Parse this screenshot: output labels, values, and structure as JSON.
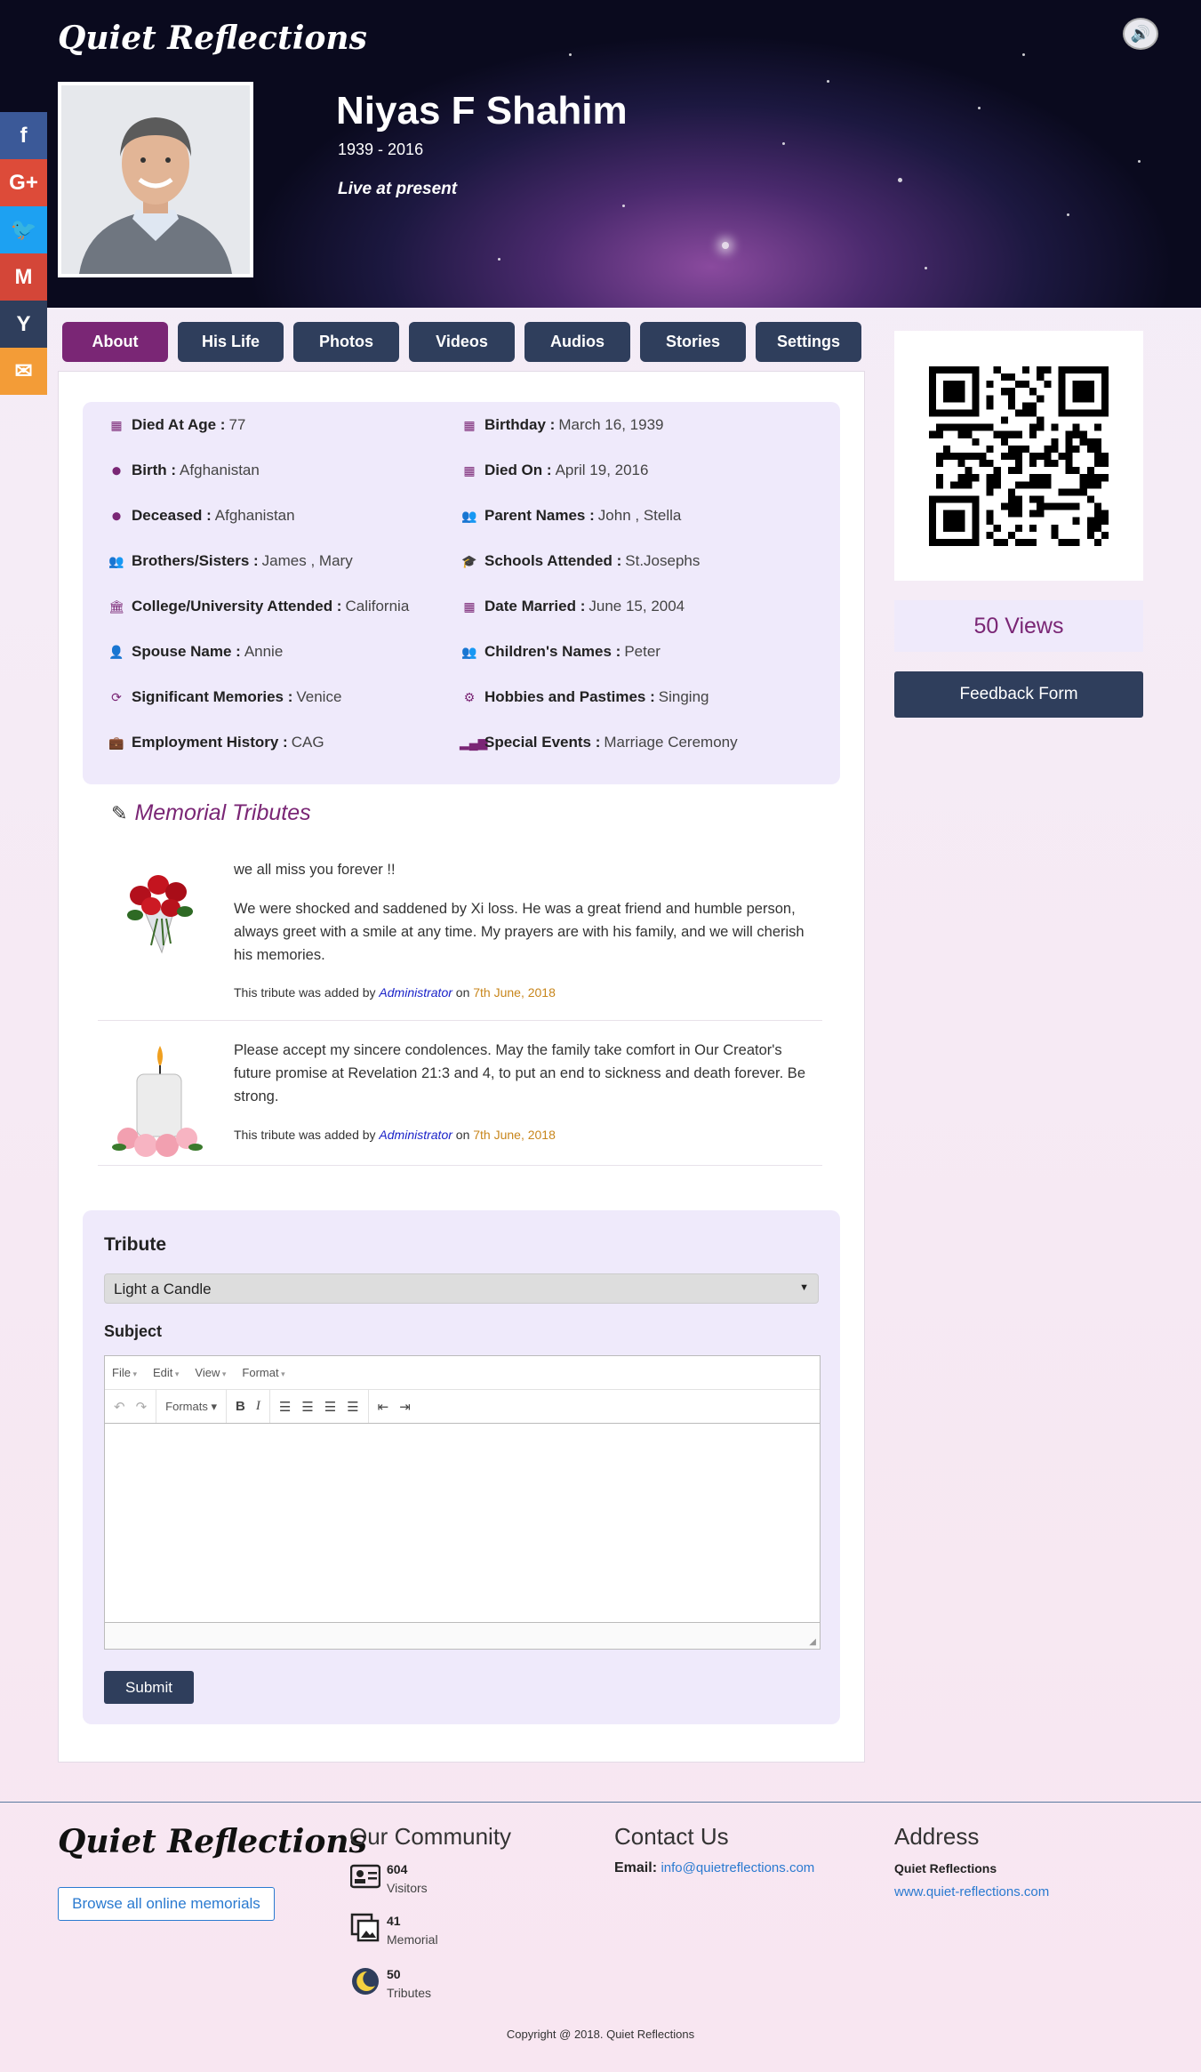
{
  "site": {
    "brand": "Quiet Reflections"
  },
  "profile": {
    "name": "Niyas F Shahim",
    "years": "1939 - 2016",
    "status": "Live at present"
  },
  "social": [
    {
      "name": "facebook",
      "glyph": "f",
      "color": "#3b5998"
    },
    {
      "name": "google-plus",
      "glyph": "G+",
      "color": "#dd4b39"
    },
    {
      "name": "twitter",
      "glyph": "🐦",
      "color": "#1da1f2"
    },
    {
      "name": "gmail",
      "glyph": "M",
      "color": "#d44638"
    },
    {
      "name": "yahoo",
      "glyph": "Y",
      "color": "#2f3e5c"
    },
    {
      "name": "email",
      "glyph": "✉",
      "color": "#f39c37"
    }
  ],
  "tabs": [
    "About",
    "His Life",
    "Photos",
    "Videos",
    "Audios",
    "Stories",
    "Settings"
  ],
  "about": {
    "left": [
      {
        "icon": "calendar-icon",
        "label": "Died At Age :",
        "value": "77"
      },
      {
        "icon": "map-marker-icon",
        "label": "Birth :",
        "value": "Afghanistan"
      },
      {
        "icon": "map-marker-icon",
        "label": "Deceased :",
        "value": "Afghanistan"
      },
      {
        "icon": "users-icon",
        "label": "Brothers/Sisters :",
        "value": "James , Mary"
      },
      {
        "icon": "university-icon",
        "label": "College/University Attended :",
        "value": "California"
      },
      {
        "icon": "user-icon",
        "label": "Spouse Name :",
        "value": "Annie"
      },
      {
        "icon": "refresh-icon",
        "label": "Significant Memories :",
        "value": "Venice"
      },
      {
        "icon": "briefcase-icon",
        "label": "Employment History :",
        "value": "CAG"
      }
    ],
    "right": [
      {
        "icon": "calendar-icon",
        "label": "Birthday :",
        "value": "March 16, 1939"
      },
      {
        "icon": "calendar-icon",
        "label": "Died On :",
        "value": "April 19, 2016"
      },
      {
        "icon": "users-icon",
        "label": "Parent Names :",
        "value": "John , Stella"
      },
      {
        "icon": "graduation-cap-icon",
        "label": "Schools Attended :",
        "value": "St.Josephs"
      },
      {
        "icon": "calendar-icon",
        "label": "Date Married :",
        "value": "June 15, 2004"
      },
      {
        "icon": "users-icon",
        "label": "Children's Names :",
        "value": "Peter"
      },
      {
        "icon": "gears-icon",
        "label": "Hobbies and Pastimes :",
        "value": "Singing"
      },
      {
        "icon": "signal-icon",
        "label": "Special Events :",
        "value": "Marriage Ceremony"
      }
    ]
  },
  "tributes": {
    "heading": "Memorial Tributes",
    "items": [
      {
        "image": "roses-icon",
        "title": "we all miss you forever !!",
        "body": "We were shocked and saddened by Xi loss. He was a great friend and humble person, always greet with a smile at any time.  My prayers are with his family, and we will cherish his memories.",
        "meta_prefix": "This tribute was added by",
        "author": "Administrator",
        "meta_on": "on",
        "date": "7th June, 2018"
      },
      {
        "image": "candle-icon",
        "title": "",
        "body": "Please accept my sincere condolences. May the family take comfort in Our Creator's future promise at Revelation 21:3 and 4,  to put an end to sickness and death forever. Be strong.",
        "meta_prefix": "This tribute was added by",
        "author": "Administrator",
        "meta_on": "on",
        "date": "7th June, 2018"
      }
    ]
  },
  "form": {
    "tribute_label": "Tribute",
    "tribute_value": "Light a Candle",
    "subject_label": "Subject",
    "menu": [
      "File",
      "Edit",
      "View",
      "Format"
    ],
    "formats_label": "Formats",
    "submit": "Submit"
  },
  "sidebar": {
    "views": "50 Views",
    "feedback": "Feedback Form"
  },
  "footer": {
    "browse": "Browse all online memorials",
    "community_heading": "Our Community",
    "stats": [
      {
        "icon": "id-card-icon",
        "number": "604",
        "label": "Visitors"
      },
      {
        "icon": "photos-icon",
        "number": "41",
        "label": "Memorial"
      },
      {
        "icon": "moon-icon",
        "number": "50",
        "label": "Tributes"
      }
    ],
    "contact_heading": "Contact Us",
    "email_label": "Email:",
    "email": "info@quietreflections.com",
    "address_heading": "Address",
    "address_name": "Quiet Reflections",
    "address_url": "www.quiet-reflections.com",
    "copyright": "Copyright @ 2018. Quiet Reflections"
  },
  "colors": {
    "accent": "#7a2675",
    "navy": "#2f3e5c",
    "panel": "#efeafb",
    "link": "#2a7ad0"
  }
}
